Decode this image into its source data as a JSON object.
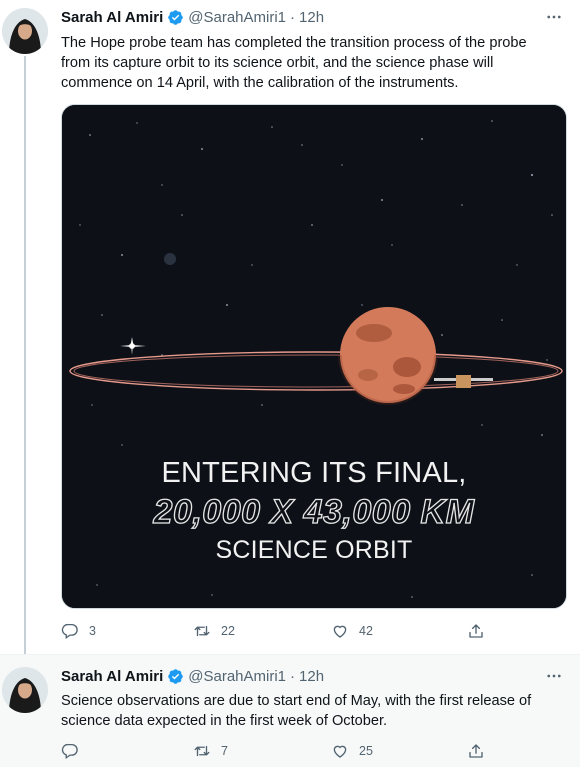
{
  "tweets": [
    {
      "author_name": "Sarah Al Amiri",
      "handle": "@SarahAmiri1",
      "separator": "·",
      "time": "12h",
      "text": "The Hope probe team has completed the transition process of the probe from its capture orbit to its science orbit, and the science phase will commence on 14 April, with the calibration of the instruments.",
      "media": {
        "line1": "ENTERING ITS FINAL,",
        "line2": "20,000 X 43,000 KM",
        "line3": "SCIENCE ORBIT"
      },
      "replies": "3",
      "retweets": "22",
      "likes": "42"
    },
    {
      "author_name": "Sarah Al Amiri",
      "handle": "@SarahAmiri1",
      "separator": "·",
      "time": "12h",
      "text": "Science observations are due to start end of May, with the first release of science data expected in the first week of October.",
      "replies": "",
      "retweets": "7",
      "likes": "25"
    }
  ],
  "icons": {
    "verified": "verified-badge-icon",
    "more": "more-dots-icon",
    "reply": "reply-icon",
    "retweet": "retweet-icon",
    "like": "heart-icon",
    "share": "share-icon"
  },
  "colors": {
    "verified": "#1d9bf0",
    "muted": "#536471",
    "text": "#0f1419",
    "thread_line": "#c4cfd6",
    "mars": "#c96a4a"
  }
}
